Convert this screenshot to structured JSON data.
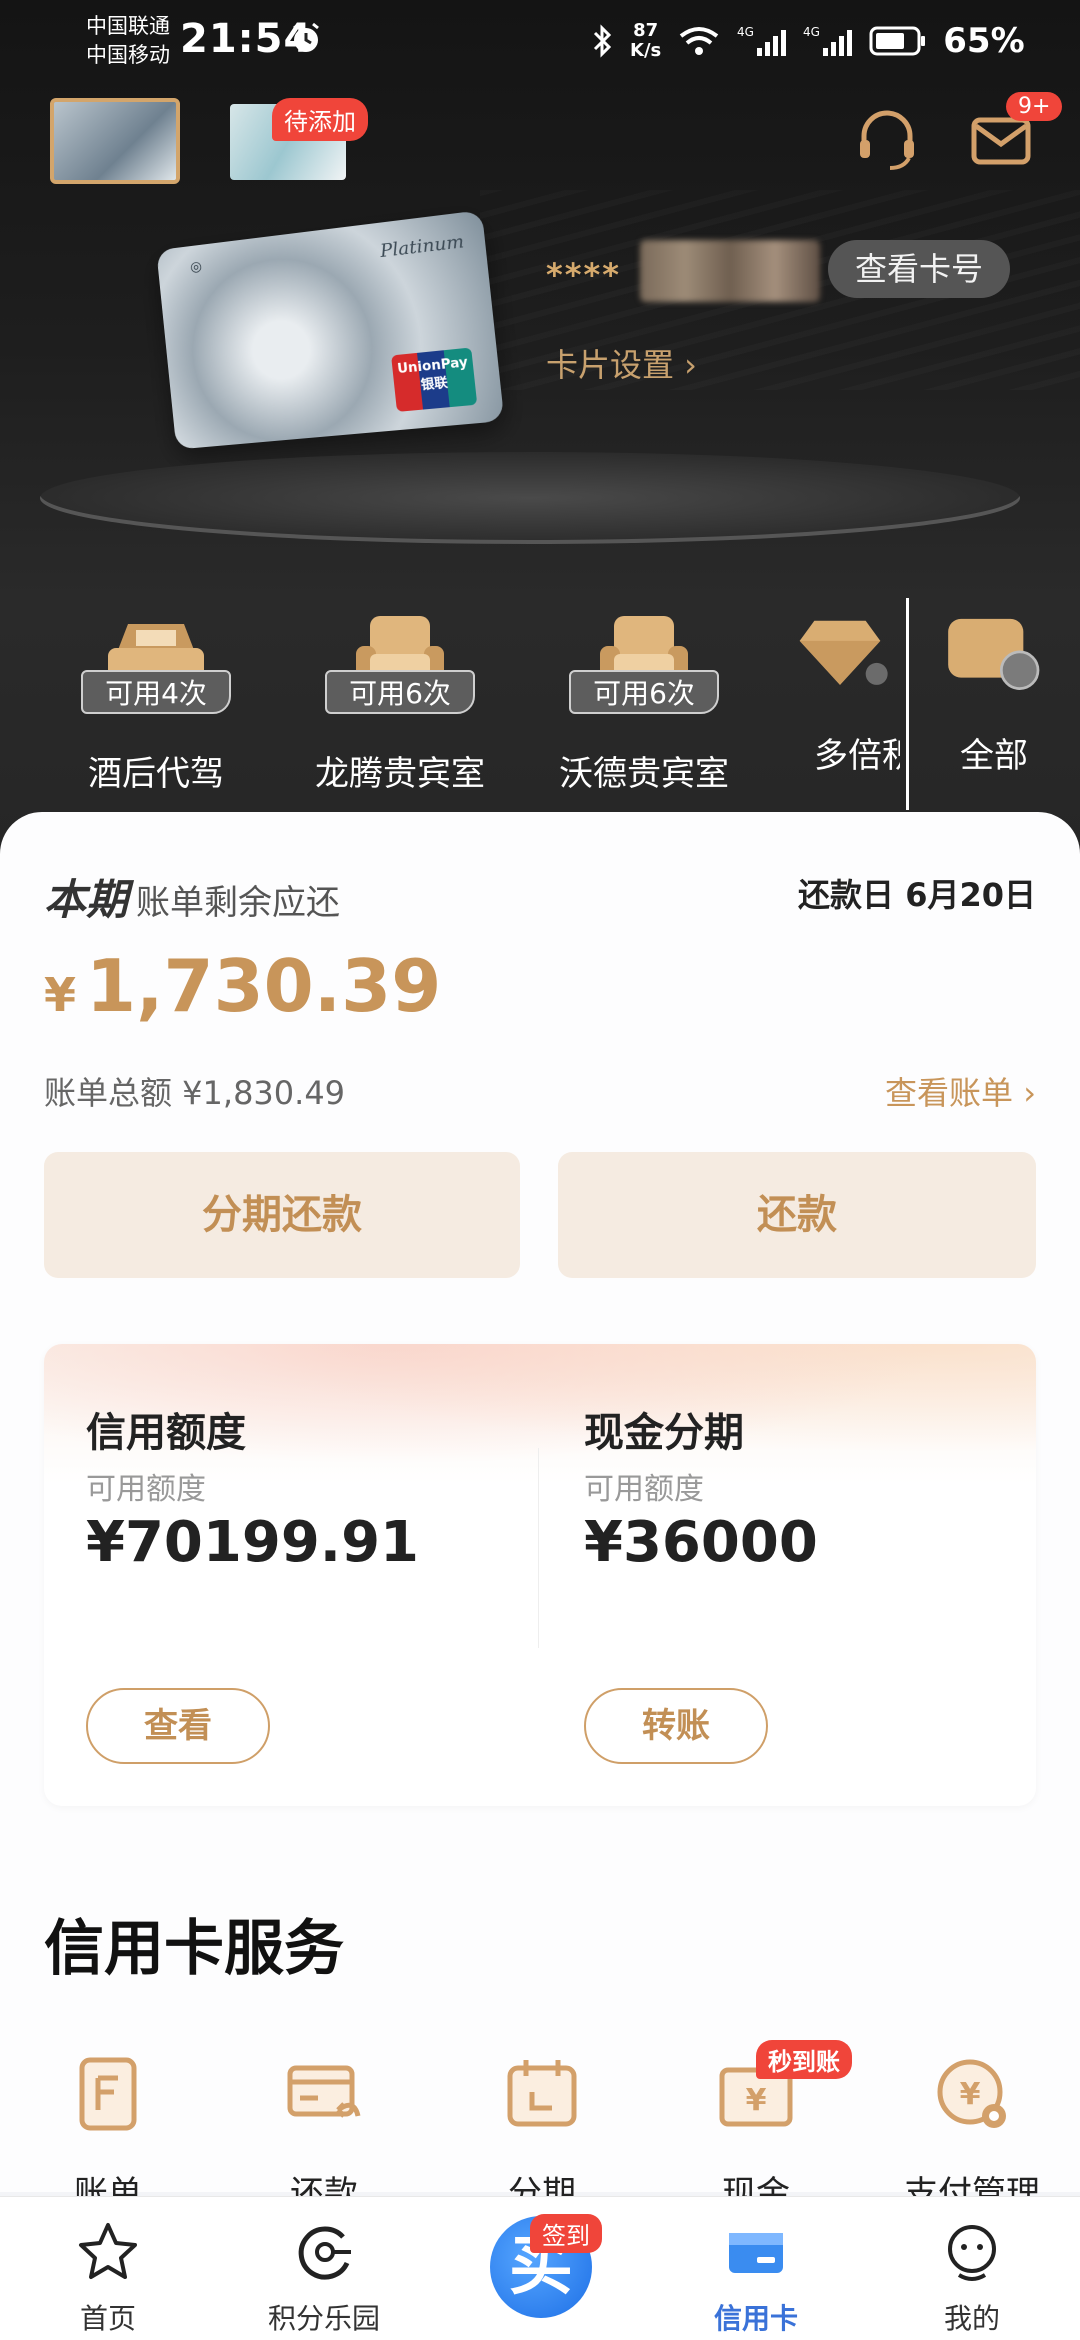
{
  "status_bar": {
    "carrier1": "中国联通",
    "carrier2": "中国移动",
    "time": "21:54",
    "net_speed_value": "87",
    "net_speed_unit": "K/s",
    "battery": "65%"
  },
  "header": {
    "pending_badge": "待添加",
    "message_badge": "9+"
  },
  "card": {
    "number_masked": "****",
    "view_number": "查看卡号",
    "settings": "卡片设置 ›",
    "platinum": "Platinum",
    "unionpay_line1": "UnionPay",
    "unionpay_line2": "银联"
  },
  "perks": [
    {
      "chip": "可用4次",
      "label": "酒后代驾",
      "icon": "car-icon"
    },
    {
      "chip": "可用6次",
      "label": "龙腾贵宾室",
      "icon": "armchair-icon"
    },
    {
      "chip": "可用6次",
      "label": "沃德贵宾室",
      "icon": "armchair-icon"
    },
    {
      "label": "多倍积",
      "icon": "diamond-icon"
    },
    {
      "label": "全部",
      "icon": "grid-icon"
    }
  ],
  "bill": {
    "period": "本期",
    "remaining_label": "账单剩余应还",
    "due_date": "还款日 6月20日",
    "currency": "¥",
    "amount": "1,730.39",
    "total": "账单总额 ¥1,830.49",
    "view_bill": "查看账单 ›",
    "installment_btn": "分期还款",
    "repay_btn": "还款"
  },
  "credit": {
    "left": {
      "title": "信用额度",
      "sub": "可用额度",
      "value": "¥70199.91",
      "button": "查看"
    },
    "right": {
      "title": "现金分期",
      "sub": "可用额度",
      "value": "¥36000",
      "button": "转账"
    }
  },
  "services": {
    "title": "信用卡服务",
    "badge": "秒到账",
    "items": [
      {
        "label": "账单",
        "icon": "bill-doc-icon"
      },
      {
        "label": "还款",
        "icon": "repay-card-icon"
      },
      {
        "label": "分期",
        "icon": "calendar-icon"
      },
      {
        "label": "现金",
        "icon": "cash-envelope-icon"
      },
      {
        "label": "支付管理",
        "icon": "payment-settings-icon"
      }
    ]
  },
  "tabbar": {
    "home": "首页",
    "points": "积分乐园",
    "center_badge": "签到",
    "center_glyph": "买",
    "credit": "信用卡",
    "mine": "我的"
  },
  "colors": {
    "accent_gold": "#c8955a",
    "badge_red": "#f0453a",
    "active_blue": "#3a72d8"
  }
}
